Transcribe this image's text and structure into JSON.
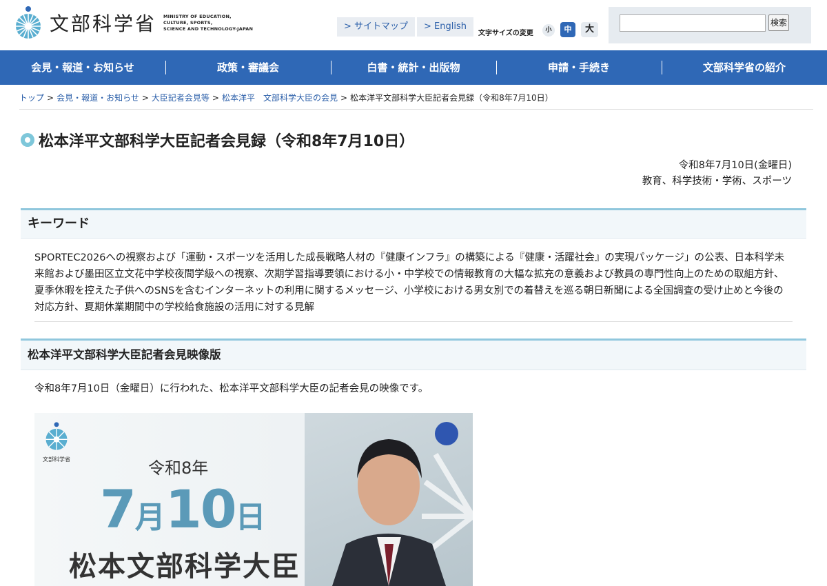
{
  "header": {
    "logo_name": "文部科学省",
    "logo_en": [
      "MINISTRY OF EDUCATION,",
      "CULTURE, SPORTS,",
      "SCIENCE AND TECHNOLOGY-JAPAN"
    ],
    "sitemap": "> サイトマップ",
    "english": "> English",
    "font_size_label": "文字サイズの変更",
    "font_small": "小",
    "font_medium": "中",
    "font_large": "大",
    "search_placeholder": "",
    "search_button": "検索"
  },
  "nav": [
    "会見・報道・お知らせ",
    "政策・審議会",
    "白書・統計・出版物",
    "申請・手続き",
    "文部科学省の紹介"
  ],
  "breadcrumb": {
    "links": [
      "トップ",
      "会見・報道・お知らせ",
      "大臣記者会見等",
      "松本洋平　文部科学大臣の会見"
    ],
    "current": "松本洋平文部科学大臣記者会見録（令和8年7月10日）"
  },
  "page": {
    "title": "松本洋平文部科学大臣記者会見録（令和8年7月10日）",
    "date": "令和8年7月10日(金曜日)",
    "categories": "教育、科学技術・学術、スポーツ"
  },
  "keywords": {
    "heading": "キーワード",
    "text": "SPORTEC2026への視察および「運動・スポーツを活用した成長戦略人材の『健康インフラ』の構築による『健康・活躍社会』の実現パッケージ」の公表、日本科学未来館および墨田区立文花中学校夜間学級への視察、次期学習指導要領における小・中学校での情報教育の大幅な拡充の意義および教員の専門性向上のための取組方針、夏季休暇を控えた子供へのSNSを含むインターネットの利用に関するメッセージ、小学校における男女別での着替えを巡る朝日新聞による全国調査の受け止めと今後の対応方針、夏期休業期間中の学校給食施設の活用に対する見解"
  },
  "video": {
    "heading": "松本洋平文部科学大臣記者会見映像版",
    "description": "令和8年7月10日（金曜日）に行われた、松本洋平文部科学大臣の記者会見の映像です。",
    "thumb_logo": "文部科学省",
    "thumb_year": "令和8年",
    "thumb_month": "7",
    "thumb_month_unit": "月",
    "thumb_day": "10",
    "thumb_day_unit": "日",
    "thumb_name": "松本文部科学大臣"
  },
  "colors": {
    "nav": "#2f68b6",
    "accent": "#90c7dd",
    "link": "#2b5fa9"
  }
}
